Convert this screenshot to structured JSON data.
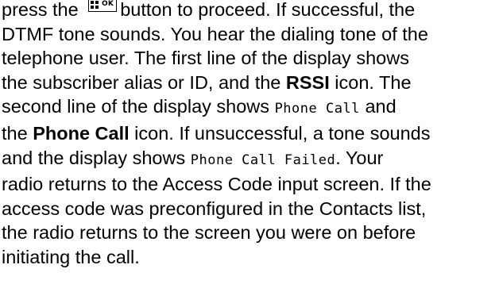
{
  "lines": [
    {
      "before": "press the",
      "after": "button to proceed. If successful, the"
    },
    "DTMF tone sounds. You hear the dialing tone of the",
    "telephone user. The first line of the display shows",
    {
      "before": "the subscriber alias or ID, and the ",
      "bold": "RSSI",
      "after": " icon. The"
    },
    {
      "before": "second line of the display shows ",
      "mono": "Phone Call",
      "after": " and"
    },
    {
      "before": "the ",
      "bold": "Phone Call",
      "after": " icon. If unsuccessful, a tone sounds"
    },
    {
      "before": "and the display shows ",
      "mono": "Phone Call Failed",
      "after": ". Your"
    },
    "radio returns to the Access Code input screen. If the",
    "access code was preconfigured in the Contacts list,",
    "the radio returns to the screen you were on before",
    "initiating the call."
  ],
  "menu_ok_key": {
    "icon": "menu-ok-key-icon",
    "label": "OK"
  }
}
